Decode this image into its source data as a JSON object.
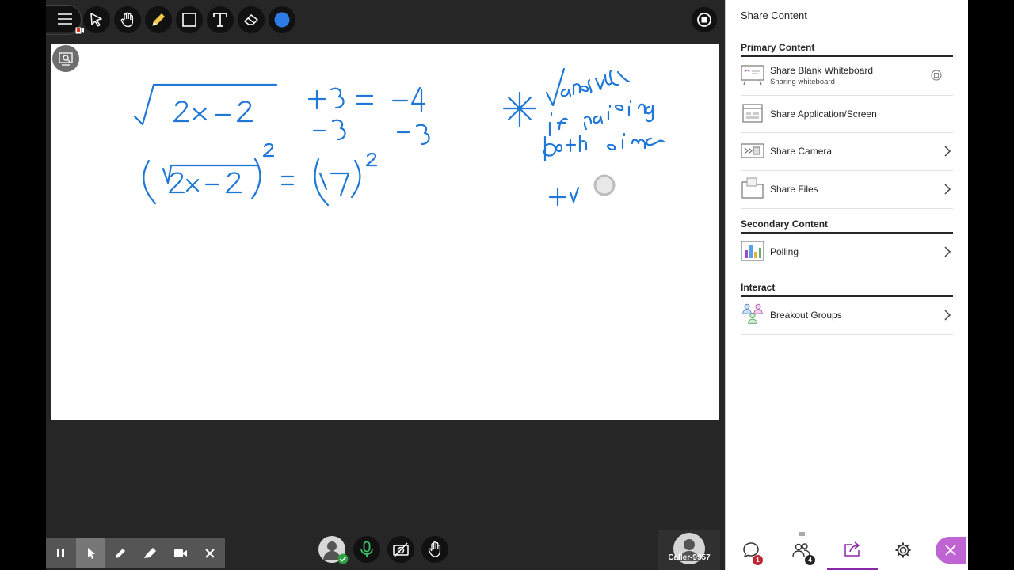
{
  "toolbar": {
    "tools": [
      "menu-icon",
      "pointer-icon",
      "pan-hand-icon",
      "pencil-icon",
      "rectangle-icon",
      "text-icon",
      "eraser-icon",
      "color-icon"
    ],
    "active_color": "#2f7be5"
  },
  "whiteboard": {
    "handwriting": {
      "line1_left": "√2x−2",
      "line1_right": "+3 = −4",
      "line2": "−3   −3",
      "line3": "(√2x−2)² = (−7)²",
      "note_line1": "√ans",
      "note_line2": "if raising",
      "note_line3": "both sides",
      "note_line4": "tr"
    }
  },
  "recording_toolbar": {
    "buttons": [
      "pause-icon",
      "pointer-icon",
      "pen-icon",
      "highlighter-icon",
      "camera-icon",
      "close-icon"
    ]
  },
  "session_controls": {
    "buttons": [
      "avatar-icon",
      "microphone-icon",
      "camera-off-icon",
      "raise-hand-icon"
    ]
  },
  "caller": {
    "name": "Caller-9957"
  },
  "panel": {
    "title": "Share Content",
    "primary": {
      "title": "Primary Content",
      "items": [
        {
          "label": "Share Blank Whiteboard",
          "sub": "Sharing whiteboard"
        },
        {
          "label": "Share Application/Screen"
        },
        {
          "label": "Share Camera"
        },
        {
          "label": "Share Files"
        }
      ]
    },
    "secondary": {
      "title": "Secondary Content",
      "items": [
        {
          "label": "Polling"
        }
      ]
    },
    "interact": {
      "title": "Interact",
      "items": [
        {
          "label": "Breakout Groups"
        }
      ]
    },
    "footer": {
      "chat_badge": "1",
      "attendees_badge": "4"
    },
    "colors": {
      "accent": "#8a27a8",
      "close_button": "#c063d3",
      "badge": "#c0262d"
    }
  }
}
